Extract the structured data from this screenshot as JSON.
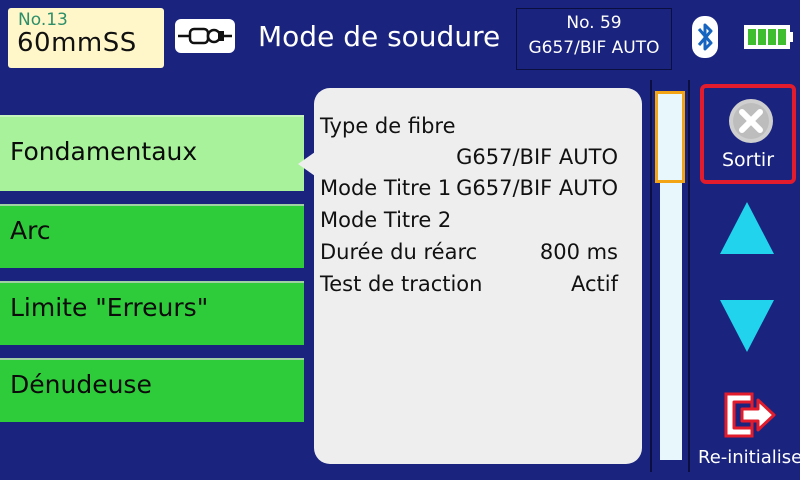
{
  "header": {
    "cleave_no": "No.13",
    "cleave_name": "60mmSS",
    "title": "Mode de soudure",
    "program_no": "No. 59",
    "program_name": "G657/BIF AUTO"
  },
  "menu": {
    "items": [
      {
        "label": "Fondamentaux",
        "selected": true
      },
      {
        "label": "Arc",
        "selected": false
      },
      {
        "label": "Limite \"Erreurs\"",
        "selected": false
      },
      {
        "label": "Dénudeuse",
        "selected": false
      }
    ]
  },
  "panel": {
    "rows": [
      {
        "label": "Type de fibre",
        "value": ""
      },
      {
        "label": "",
        "value": "G657/BIF AUTO"
      },
      {
        "label": "Mode Titre 1",
        "value": "G657/BIF AUTO"
      },
      {
        "label": "Mode Titre 2",
        "value": ""
      },
      {
        "label": "Durée du réarc",
        "value": "800 ms"
      },
      {
        "label": "Test de traction",
        "value": "Actif"
      }
    ]
  },
  "buttons": {
    "exit_label": "Sortir",
    "reset_label": "Re-initialise"
  },
  "icons": {
    "fiber": "fiber-holder-icon",
    "bluetooth": "bluetooth-icon",
    "battery": "battery-icon",
    "exit": "close-circle-icon",
    "up": "triangle-up-icon",
    "down": "triangle-down-icon",
    "reset": "exit-arrow-icon"
  },
  "colors": {
    "background": "#1a237e",
    "menu_item": "#2ecc3a",
    "menu_selected": "#a7f29a",
    "exit_border": "#e21c2c",
    "scroll_thumb": "#f2a414",
    "arrow": "#22d3ee"
  }
}
